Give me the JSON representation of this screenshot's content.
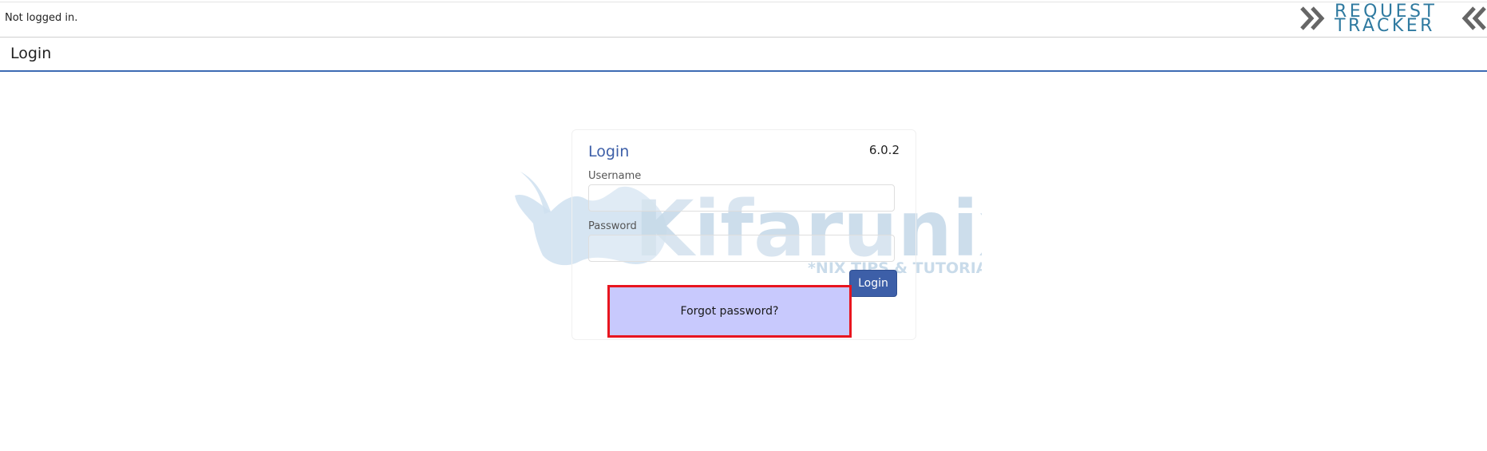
{
  "status": {
    "text": "Not logged in."
  },
  "logo": {
    "line1": "REQUEST",
    "line2": "TRACKER",
    "color": "#2f7aa0"
  },
  "page": {
    "title": "Login"
  },
  "watermark": {
    "brand": "Kifarunix",
    "tagline": "*NIX TIPS & TUTORIALS"
  },
  "login_form": {
    "title": "Login",
    "version": "6.0.2",
    "username_label": "Username",
    "username_value": "",
    "password_label": "Password",
    "password_value": "",
    "submit_label": "Login",
    "forgot_label": "Forgot password?"
  },
  "colors": {
    "accent": "#3d5fa8",
    "highlight_fill": "#c8c9fd",
    "highlight_border": "#e8151f"
  }
}
